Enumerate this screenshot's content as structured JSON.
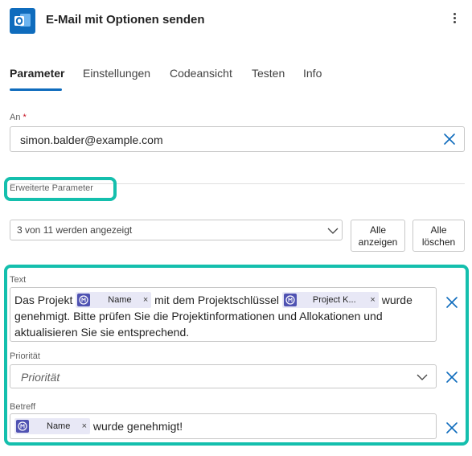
{
  "header": {
    "title": "E-Mail mit Optionen senden",
    "app_icon": "outlook-icon",
    "more_icon": "more-vertical-icon"
  },
  "tabs": [
    {
      "label": "Parameter",
      "active": true
    },
    {
      "label": "Einstellungen",
      "active": false
    },
    {
      "label": "Codeansicht",
      "active": false
    },
    {
      "label": "Testen",
      "active": false
    },
    {
      "label": "Info",
      "active": false
    }
  ],
  "to_field": {
    "label": "An",
    "required_marker": "*",
    "value": "simon.balder@example.com"
  },
  "advanced": {
    "label": "Erweiterte Parameter",
    "select_value": "3 von 11 werden angezeigt",
    "show_all_line1": "Alle",
    "show_all_line2": "anzeigen",
    "clear_all_line1": "Alle",
    "clear_all_line2": "löschen"
  },
  "text_field": {
    "label": "Text",
    "part1": "Das Projekt",
    "token1": "Name",
    "part2": "mit dem Projektschlüssel",
    "token2": "Project K...",
    "part3": "wurde",
    "part4": "genehmigt. Bitte prüfen Sie die Projektinformationen und Allokationen und",
    "part5": "aktualisieren Sie sie entsprechend."
  },
  "priority_field": {
    "label": "Priorität",
    "placeholder": "Priorität"
  },
  "subject_field": {
    "label": "Betreff",
    "token": "Name",
    "text": "wurde genehmigt!"
  },
  "colors": {
    "accent": "#0f6cbd",
    "highlight": "#14bfad",
    "token_bg": "#e8e8f6",
    "token_icon": "#4f52b2",
    "required": "#c50f1f"
  }
}
